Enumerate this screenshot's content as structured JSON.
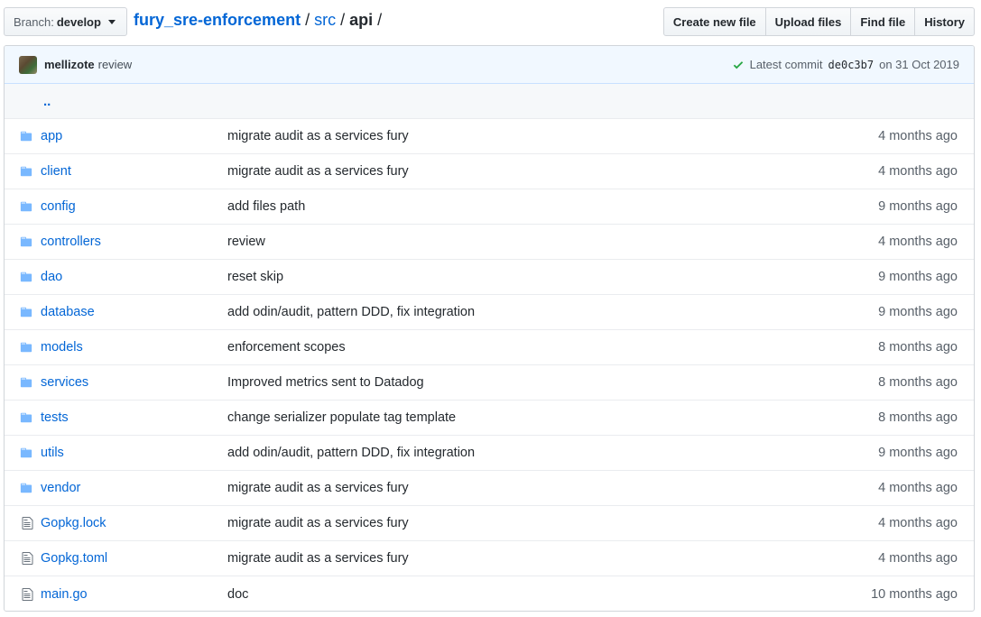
{
  "branch": {
    "prefix": "Branch:",
    "name": "develop"
  },
  "breadcrumb": {
    "repo": "fury_sre-enforcement",
    "sep": "/",
    "src": "src",
    "current": "api"
  },
  "actions": {
    "create": "Create new file",
    "upload": "Upload files",
    "find": "Find file",
    "history": "History"
  },
  "commit": {
    "author": "mellizote",
    "message": "review",
    "latest_label": "Latest commit",
    "sha": "de0c3b7",
    "date_label": "on 31 Oct 2019"
  },
  "up_dir": "..",
  "files": [
    {
      "type": "folder",
      "icon": "folder-icon",
      "name": "app",
      "message": "migrate audit as a services fury",
      "age": "4 months ago"
    },
    {
      "type": "folder",
      "icon": "folder-icon",
      "name": "client",
      "message": "migrate audit as a services fury",
      "age": "4 months ago"
    },
    {
      "type": "folder",
      "icon": "folder-icon",
      "name": "config",
      "message": "add files path",
      "age": "9 months ago"
    },
    {
      "type": "folder",
      "icon": "folder-icon",
      "name": "controllers",
      "message": "review",
      "age": "4 months ago"
    },
    {
      "type": "folder",
      "icon": "folder-icon",
      "name": "dao",
      "message": "reset skip",
      "age": "9 months ago"
    },
    {
      "type": "folder",
      "icon": "folder-icon",
      "name": "database",
      "message": "add odin/audit, pattern DDD, fix integration",
      "age": "9 months ago"
    },
    {
      "type": "folder",
      "icon": "folder-icon",
      "name": "models",
      "message": "enforcement scopes",
      "age": "8 months ago"
    },
    {
      "type": "folder",
      "icon": "folder-icon",
      "name": "services",
      "message": "Improved metrics sent to Datadog",
      "age": "8 months ago"
    },
    {
      "type": "folder",
      "icon": "folder-icon",
      "name": "tests",
      "message": "change serializer populate tag template",
      "age": "8 months ago"
    },
    {
      "type": "folder",
      "icon": "folder-icon",
      "name": "utils",
      "message": "add odin/audit, pattern DDD, fix integration",
      "age": "9 months ago"
    },
    {
      "type": "folder",
      "icon": "folder-icon",
      "name": "vendor",
      "message": "migrate audit as a services fury",
      "age": "4 months ago"
    },
    {
      "type": "file",
      "icon": "file-icon",
      "name": "Gopkg.lock",
      "message": "migrate audit as a services fury",
      "age": "4 months ago"
    },
    {
      "type": "file",
      "icon": "file-icon",
      "name": "Gopkg.toml",
      "message": "migrate audit as a services fury",
      "age": "4 months ago"
    },
    {
      "type": "file",
      "icon": "file-icon",
      "name": "main.go",
      "message": "doc",
      "age": "10 months ago"
    }
  ],
  "colors": {
    "link": "#0366d6",
    "folder": "#79b8ff",
    "check": "#28a745",
    "commit_bg": "#f1f8ff"
  }
}
